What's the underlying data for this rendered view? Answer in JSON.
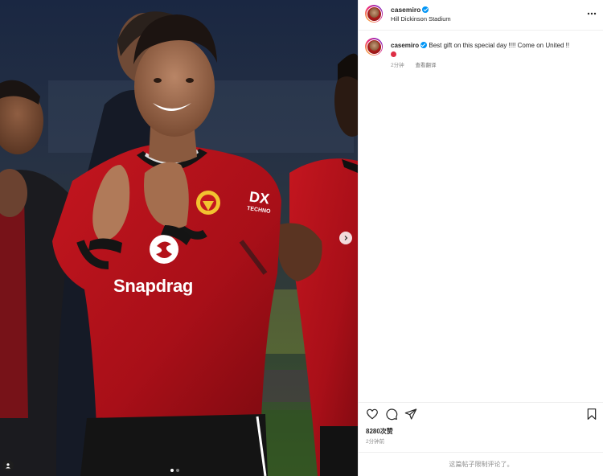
{
  "post": {
    "username": "casemiro",
    "location": "Hill Dickinson Stadium",
    "caption_text": "Best gift on this special day !!!! Come on United !!",
    "caption_emoji": "red-circle",
    "caption_time": "2分钟",
    "translate_label": "查看翻译",
    "likes": "8280次赞",
    "post_time": "2分钟前",
    "comments_limited": "这篇帖子限制评论了。"
  },
  "photo": {
    "jersey_sponsor": "Snapdrag",
    "sleeve_sponsor_top": "DX",
    "sleeve_sponsor_bottom": "TECHNO",
    "carousel_total": 2,
    "carousel_active": 1
  },
  "icons": {
    "more": "more-horizontal-icon",
    "like": "heart-icon",
    "comment": "comment-bubble-icon",
    "share": "paper-plane-icon",
    "save": "bookmark-icon",
    "verified": "verified-badge-icon",
    "carousel_next": "chevron-right-icon",
    "tagged": "user-tag-icon"
  },
  "colors": {
    "verified_blue": "#0095f6",
    "jersey_red": "#b3121a",
    "muted_text": "#8e8e8e",
    "divider": "#efefef"
  }
}
